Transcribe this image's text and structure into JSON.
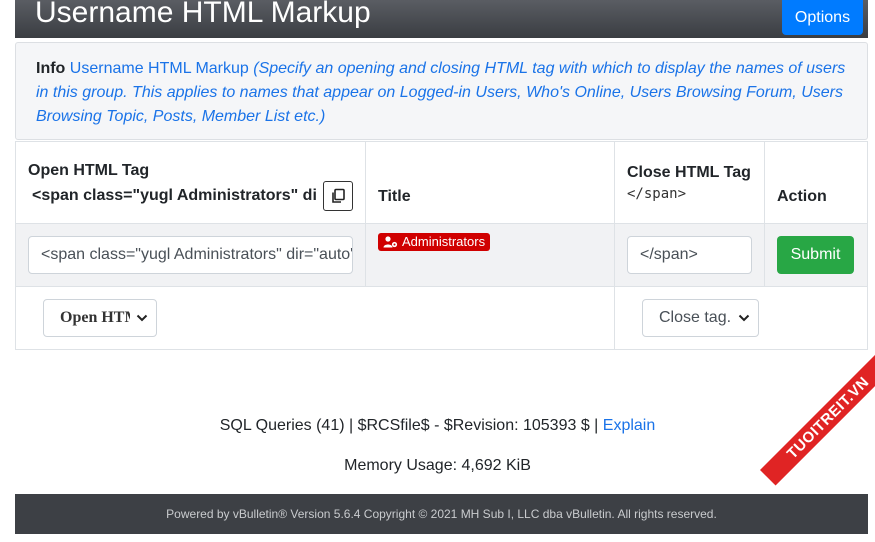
{
  "header": {
    "title": "Username HTML Markup",
    "options_label": "Options"
  },
  "info": {
    "label": "Info",
    "name": "Username HTML Markup",
    "description": "(Specify an opening and closing HTML tag with which to display the names of users in this group. This applies to names that appear on Logged-in Users, Who's Online, Users Browsing Forum, Users Browsing Topic, Posts, Member List etc.)"
  },
  "table": {
    "headers": {
      "open": "Open HTML Tag",
      "open_preview": "<span class=\"yugl Administrators\" dir=\"auto\">",
      "title": "Title",
      "close": "Close HTML Tag",
      "close_preview": "</span>",
      "action": "Action"
    },
    "row": {
      "open_value": "<span class=\"yugl Administrators\" dir=\"auto\">",
      "title_badge": "Administrators",
      "close_value": "</span>",
      "submit_label": "Submit"
    },
    "selects": {
      "open_selected": "Open HTML",
      "close_selected": "Close tag..."
    }
  },
  "footer": {
    "sql_text": "SQL Queries (41) | $RCSfile$ - $Revision: 105393 $ | ",
    "explain_link": "Explain",
    "memory": "Memory Usage: 4,692 KiB",
    "copyright": "Powered by vBulletin® Version 5.6.4 Copyright © 2021 MH Sub I, LLC dba vBulletin. All rights reserved."
  },
  "watermark": "TUOITREIT.VN",
  "colors": {
    "primary": "#007bff",
    "success": "#28a745",
    "badge": "#d00000",
    "link": "#1a73e8"
  },
  "icons": [
    "copy-icon",
    "user-cog-icon",
    "chevron-down-icon"
  ]
}
